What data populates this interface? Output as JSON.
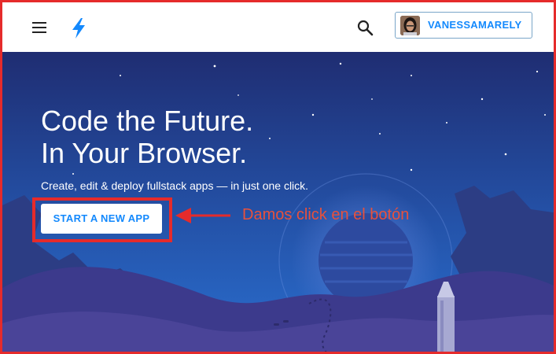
{
  "header": {
    "menu_icon": "hamburger-menu-icon",
    "logo_icon": "lightning-bolt-icon",
    "search_icon": "search-icon",
    "user": {
      "label": "VANESSAMARELY",
      "avatar": "user-avatar"
    }
  },
  "hero": {
    "headline_line1": "Code the Future.",
    "headline_line2": "In Your Browser.",
    "subtext": "Create, edit & deploy fullstack apps — in just one click.",
    "cta_label": "START A NEW APP"
  },
  "annotation": {
    "note": "Damos click en el botón",
    "color": "#e52b2b"
  },
  "colors": {
    "accent": "#1389fd",
    "hero_top": "#1f2d72",
    "hero_bottom": "#2a6fd0"
  }
}
